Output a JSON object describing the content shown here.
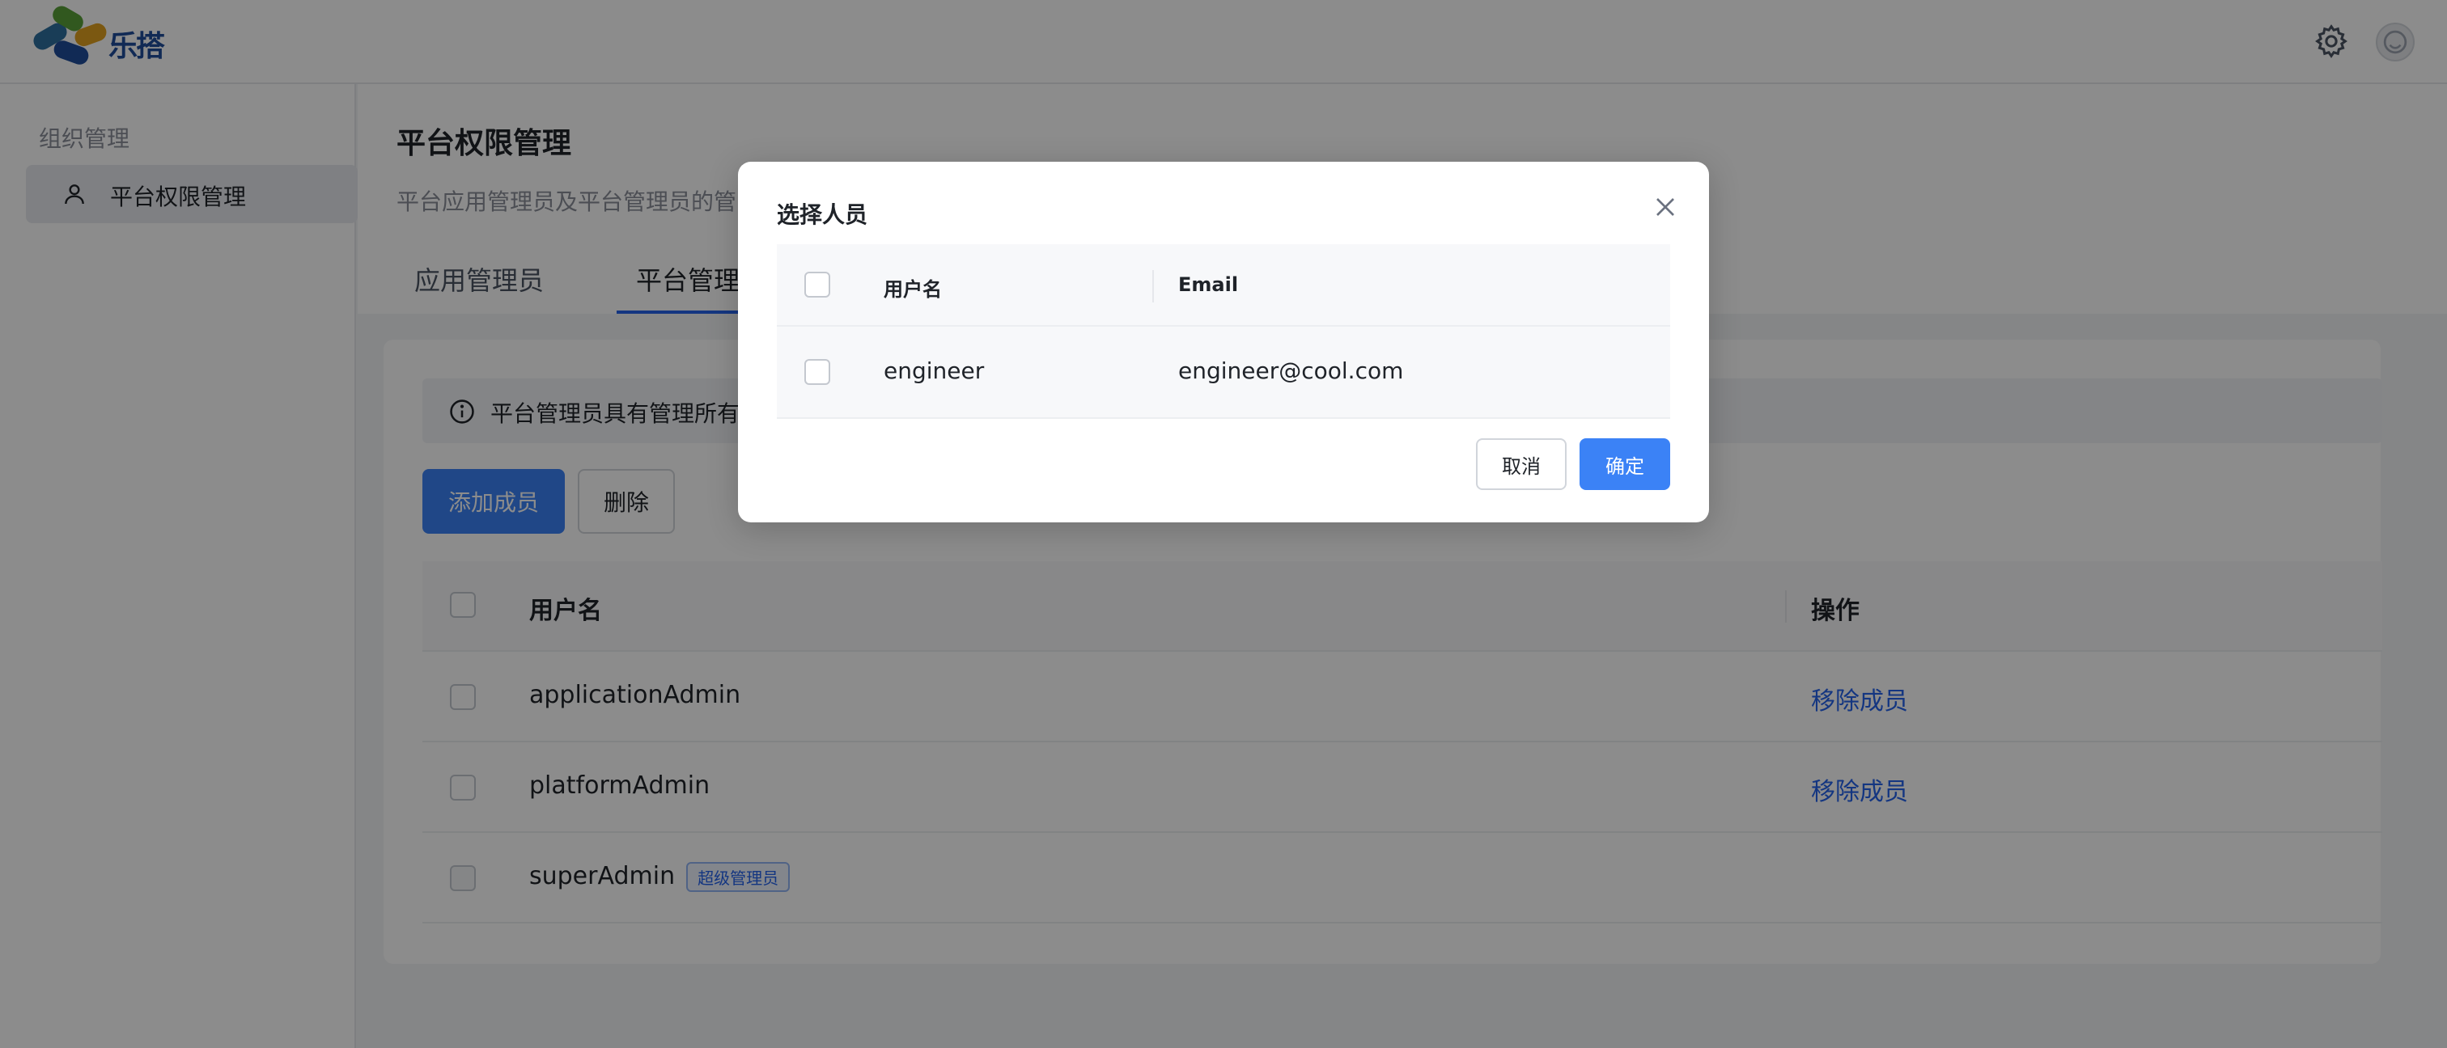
{
  "header": {
    "logo_text": "乐搭",
    "settings_icon": "gear-icon",
    "avatar_icon": "user-avatar-icon"
  },
  "sidebar": {
    "group_label": "组织管理",
    "items": [
      {
        "label": "平台权限管理",
        "icon": "user-icon",
        "active": true
      }
    ]
  },
  "main": {
    "title": "平台权限管理",
    "description": "平台应用管理员及平台管理员的管",
    "tabs": [
      {
        "label": "应用管理员",
        "active": false
      },
      {
        "label": "平台管理",
        "active": true
      }
    ],
    "alert_text": "平台管理员具有管理所有",
    "add_button": "添加成员",
    "delete_button": "删除",
    "table": {
      "columns": [
        "用户名",
        "操作"
      ],
      "rows": [
        {
          "username": "applicationAdmin",
          "action": "移除成员",
          "tag": ""
        },
        {
          "username": "platformAdmin",
          "action": "移除成员",
          "tag": ""
        },
        {
          "username": "superAdmin",
          "action": "",
          "tag": "超级管理员"
        }
      ]
    }
  },
  "modal": {
    "title": "选择人员",
    "columns": [
      "用户名",
      "Email"
    ],
    "rows": [
      {
        "username": "engineer",
        "email": "engineer@cool.com"
      }
    ],
    "cancel_label": "取消",
    "confirm_label": "确定"
  },
  "colors": {
    "primary": "#3b82f6",
    "link": "#2563eb",
    "mask": "rgba(0,0,0,0.45)"
  }
}
